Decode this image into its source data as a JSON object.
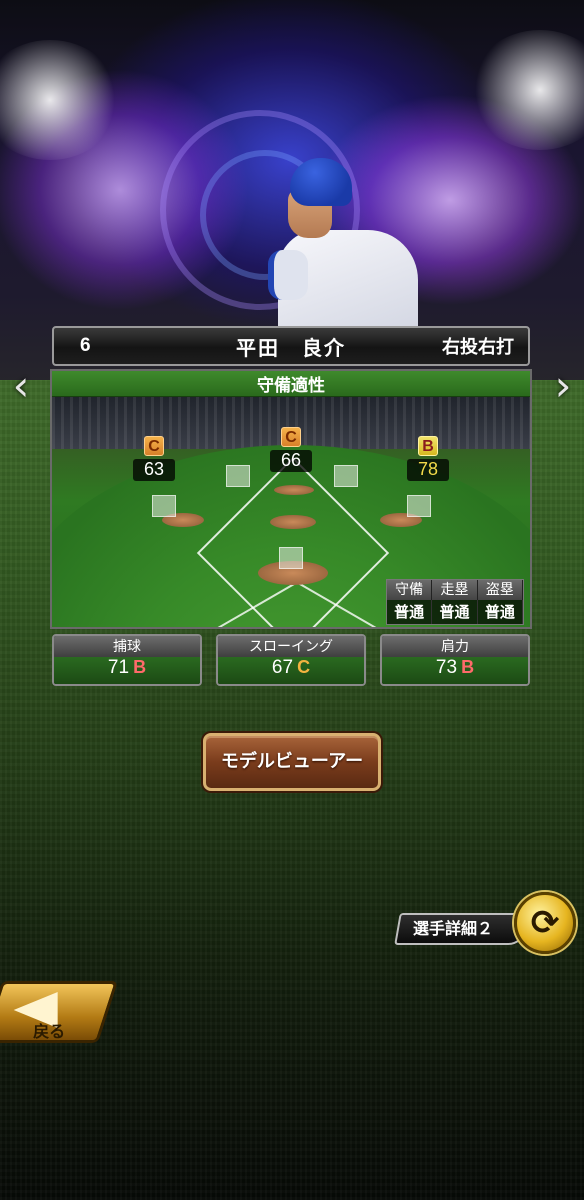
{
  "player": {
    "number": "6",
    "name": "平田　良介",
    "bat_throw": "右投右打"
  },
  "defense_panel": {
    "title": "守備適性",
    "positions": [
      {
        "id": "left-field",
        "grade": "C",
        "value": "63"
      },
      {
        "id": "center-field",
        "grade": "C",
        "value": "66"
      },
      {
        "id": "right-field",
        "grade": "B",
        "value": "78"
      }
    ],
    "ratings": {
      "headers": [
        "守備",
        "走塁",
        "盗塁"
      ],
      "values": [
        "普通",
        "普通",
        "普通"
      ]
    }
  },
  "stats": [
    {
      "label": "捕球",
      "value": "71",
      "grade": "B"
    },
    {
      "label": "スローイング",
      "value": "67",
      "grade": "C"
    },
    {
      "label": "肩力",
      "value": "73",
      "grade": "B"
    }
  ],
  "buttons": {
    "model_viewer": "モデルビューアー",
    "player_detail_2": "選手詳細２",
    "back": "戻る"
  },
  "colors": {
    "grade_b": "#ff6a6a",
    "grade_c": "#f3b440",
    "panel_green": "#3f8a2c"
  }
}
